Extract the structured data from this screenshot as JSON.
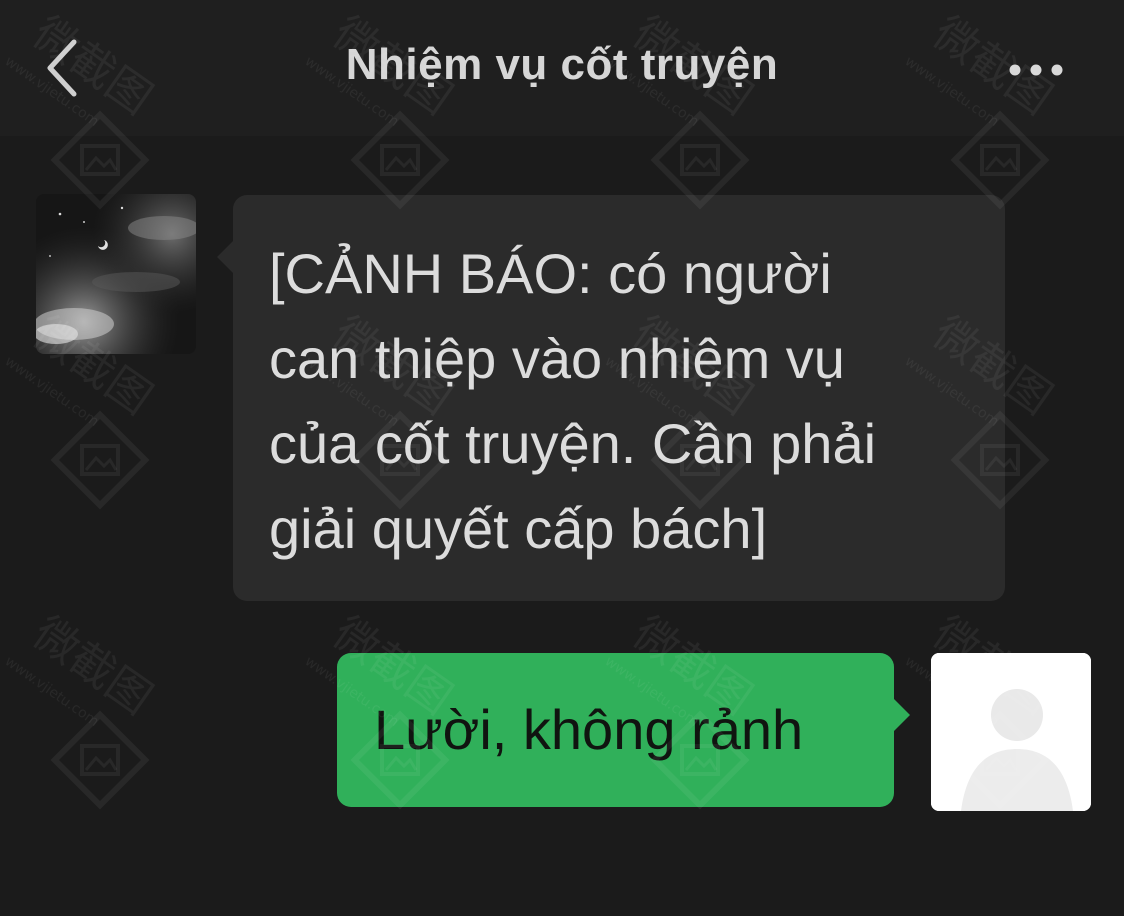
{
  "header": {
    "title": "Nhiệm vụ cốt truyện",
    "back_icon": "chevron-left-icon",
    "more_icon": "more-horizontal-icon"
  },
  "messages": [
    {
      "side": "left",
      "avatar": "night-sky-avatar",
      "text": "[CẢNH BÁO: có người can thiệp vào nhiệm vụ của cốt truyện. Cần phải giải quyết cấp bách]",
      "lines": [
        "[CẢNH BÁO: có người",
        "can thiệp vào nhiệm vụ",
        "của cốt truyện. Cần phải",
        "giải quyết cấp bách]"
      ],
      "bubble_color": "#2b2b2b"
    },
    {
      "side": "right",
      "avatar": "default-user-avatar",
      "text": "Lười, không rảnh",
      "bubble_color": "#30b05a"
    }
  ],
  "watermark": {
    "brand": "微截图",
    "url": "www.vjietu.com"
  },
  "colors": {
    "background": "#1b1b1b",
    "header": "#1f1f1f",
    "incoming_bubble": "#2b2b2b",
    "outgoing_bubble": "#30b05a"
  }
}
